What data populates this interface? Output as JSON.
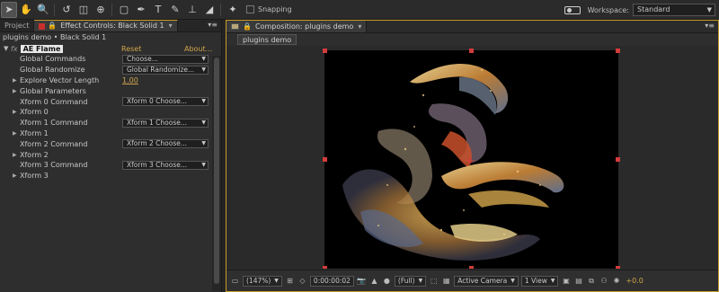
{
  "toolbar": {
    "tools": [
      "selection-tool",
      "hand-tool",
      "zoom-tool",
      "rotation-tool",
      "orbit-camera-tool",
      "pan-behind-tool",
      "rectangle-tool",
      "pen-tool",
      "type-tool",
      "brush-tool",
      "clone-stamp-tool",
      "eraser-tool",
      "puppet-pin-tool"
    ],
    "snapping_label": "Snapping",
    "workspace_label": "Workspace:",
    "workspace_value": "Standard"
  },
  "left_panel": {
    "project_tab": "Project",
    "effect_controls_tab": "Effect Controls: Black Solid 1",
    "layer_path": "plugins demo • Black Solid 1",
    "effect": {
      "fx": "fx",
      "name": "AE Flame",
      "reset": "Reset",
      "about": "About..."
    },
    "params": [
      {
        "label": "Global Commands",
        "control": "dropdown",
        "value": "Choose..."
      },
      {
        "label": "Global Randomize",
        "control": "dropdown",
        "value": "Global Randomize..."
      },
      {
        "label": "Explore Vector Length",
        "control": "value",
        "value": "1.00"
      },
      {
        "label": "Global Parameters",
        "control": "group",
        "value": ""
      },
      {
        "label": "Xform 0 Command",
        "control": "dropdown",
        "value": "Xform 0 Choose..."
      },
      {
        "label": "Xform 0",
        "control": "group",
        "value": ""
      },
      {
        "label": "Xform 1 Command",
        "control": "dropdown",
        "value": "Xform 1 Choose..."
      },
      {
        "label": "Xform 1",
        "control": "group",
        "value": ""
      },
      {
        "label": "Xform 2 Command",
        "control": "dropdown",
        "value": "Xform 2 Choose..."
      },
      {
        "label": "Xform 2",
        "control": "group",
        "value": ""
      },
      {
        "label": "Xform 3 Command",
        "control": "dropdown",
        "value": "Xform 3 Choose..."
      },
      {
        "label": "Xform 3",
        "control": "group",
        "value": ""
      }
    ]
  },
  "comp_panel": {
    "tab_label": "Composition: plugins demo",
    "subtab_label": "plugins demo",
    "controls": {
      "magnification": "(147%)",
      "timecode": "0:00:00:02",
      "resolution": "(Full)",
      "camera": "Active Camera",
      "views": "1 View",
      "exposure": "+0.0"
    }
  },
  "colors": {
    "accent_orange": "#d1a54a",
    "panel_border_active": "#c79a2a",
    "handle_red": "#d43b3b",
    "label_red": "#c9302c"
  }
}
